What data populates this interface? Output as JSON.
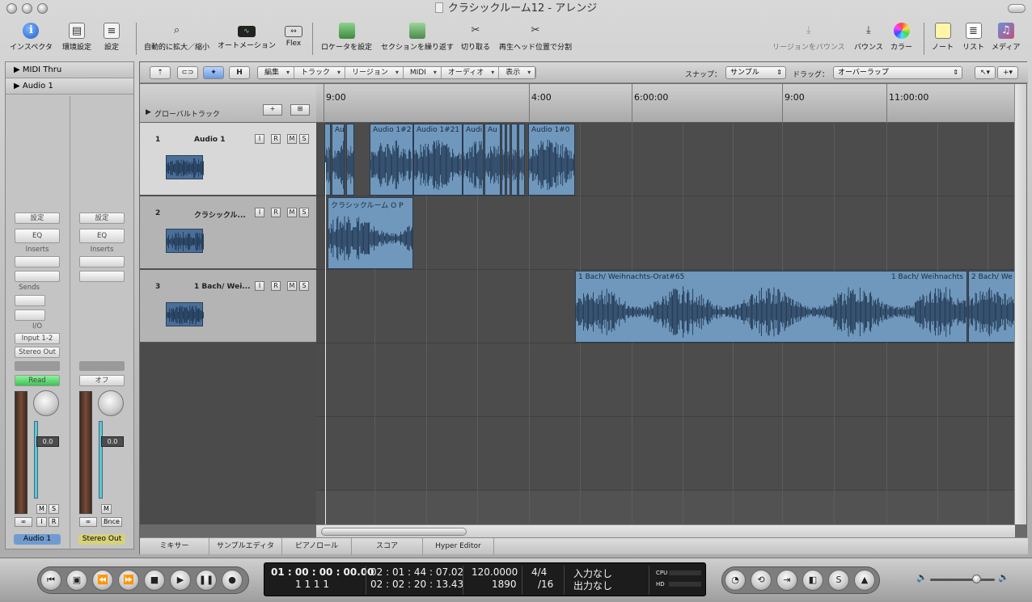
{
  "window": {
    "title": "クラシックルーム12 - アレンジ"
  },
  "toolbar": {
    "items": [
      {
        "label": "インスペクタ",
        "icon": "info-icon"
      },
      {
        "label": "環境設定",
        "icon": "preferences-icon"
      },
      {
        "label": "設定",
        "icon": "settings-icon"
      },
      {
        "label": "自動的に拡大／縮小",
        "icon": "zoom-icon"
      },
      {
        "label": "オートメーション",
        "icon": "automation-icon"
      },
      {
        "label": "Flex",
        "icon": "flex-icon"
      },
      {
        "label": "ロケータを設定",
        "icon": "set-locators-icon"
      },
      {
        "label": "セクションを繰り返す",
        "icon": "repeat-section-icon"
      },
      {
        "label": "切り取る",
        "icon": "cut-icon"
      },
      {
        "label": "再生ヘッド位置で分割",
        "icon": "split-icon"
      },
      {
        "label": "リージョンをバウンス",
        "icon": "bounce-region-icon"
      },
      {
        "label": "バウンス",
        "icon": "bounce-icon"
      },
      {
        "label": "カラー",
        "icon": "color-wheel-icon"
      },
      {
        "label": "ノート",
        "icon": "notes-icon"
      },
      {
        "label": "リスト",
        "icon": "list-icon"
      },
      {
        "label": "メディア",
        "icon": "media-icon"
      }
    ]
  },
  "inspector": {
    "rows": [
      "MIDI Thru",
      "Audio 1"
    ],
    "strips": [
      {
        "settings": "設定",
        "eq": "EQ",
        "inserts": "Inserts",
        "sends": "Sends",
        "io": "I/O",
        "input": "Input 1-2",
        "output": "Stereo Out",
        "automation": "Read",
        "fader_value": "0.0",
        "m": "M",
        "s": "S",
        "i": "I",
        "r": "R",
        "name": "Audio 1",
        "name_color": "#6f9bd1",
        "automation_color": "#56d36a"
      },
      {
        "settings": "設定",
        "eq": "EQ",
        "inserts": "Inserts",
        "automation": "オフ",
        "fader_value": "0.0",
        "m": "M",
        "bounce": "Bnce",
        "name": "Stereo Out",
        "name_color": "#d7d17a"
      }
    ]
  },
  "localbar": {
    "h_button": "H",
    "menus": [
      "編集",
      "トラック",
      "リージョン",
      "MIDI",
      "オーディオ",
      "表示"
    ],
    "snap_label": "スナップ：",
    "snap_value": "サンプル",
    "drag_label": "ドラッグ：",
    "drag_value": "オーバーラップ"
  },
  "global_tracks": {
    "label": "グローバルトラック",
    "add_button": "+"
  },
  "ruler": {
    "ticks": [
      "9:00",
      "4:00",
      "6:00:00",
      "9:00",
      "11:00:00"
    ]
  },
  "tracks": [
    {
      "number": "1",
      "name": "Audio 1",
      "i": "I",
      "r": "R",
      "m": "M",
      "s": "S"
    },
    {
      "number": "2",
      "name": "クラシックル...",
      "i": "I",
      "r": "R",
      "m": "M",
      "s": "S"
    },
    {
      "number": "3",
      "name": "1 Bach/ Wei...",
      "i": "I",
      "r": "R",
      "m": "M",
      "s": "S"
    }
  ],
  "regions": {
    "track1": [
      "",
      "Au",
      "",
      "Audio 1#2",
      "Audio 1#21",
      "Audi",
      "Au",
      "",
      "",
      "",
      "",
      "Audio 1#0"
    ],
    "track2": [
      "クラシックルーム O P"
    ],
    "track3": [
      "1 Bach/ Weihnachts-Orat#65",
      "1 Bach/ Weihnachts",
      "2 Bach/ We"
    ]
  },
  "tabs": [
    "ミキサー",
    "サンプルエディタ",
    "ピアノロール",
    "スコア",
    "Hyper Editor"
  ],
  "transport": {
    "smpte": "01 : 00 : 00 : 00.00",
    "bars": "1      1      1      1",
    "position_time": "02 : 01 : 44 : 07.02",
    "position_time2": "02 : 02 : 20 : 13.43",
    "tempo": "120.0000",
    "tempo_sub": "1890",
    "signature": "4/4",
    "division": "/16",
    "midi_in": "入力なし",
    "midi_out": "出力なし",
    "cpu_label": "CPU",
    "hd_label": "HD"
  }
}
